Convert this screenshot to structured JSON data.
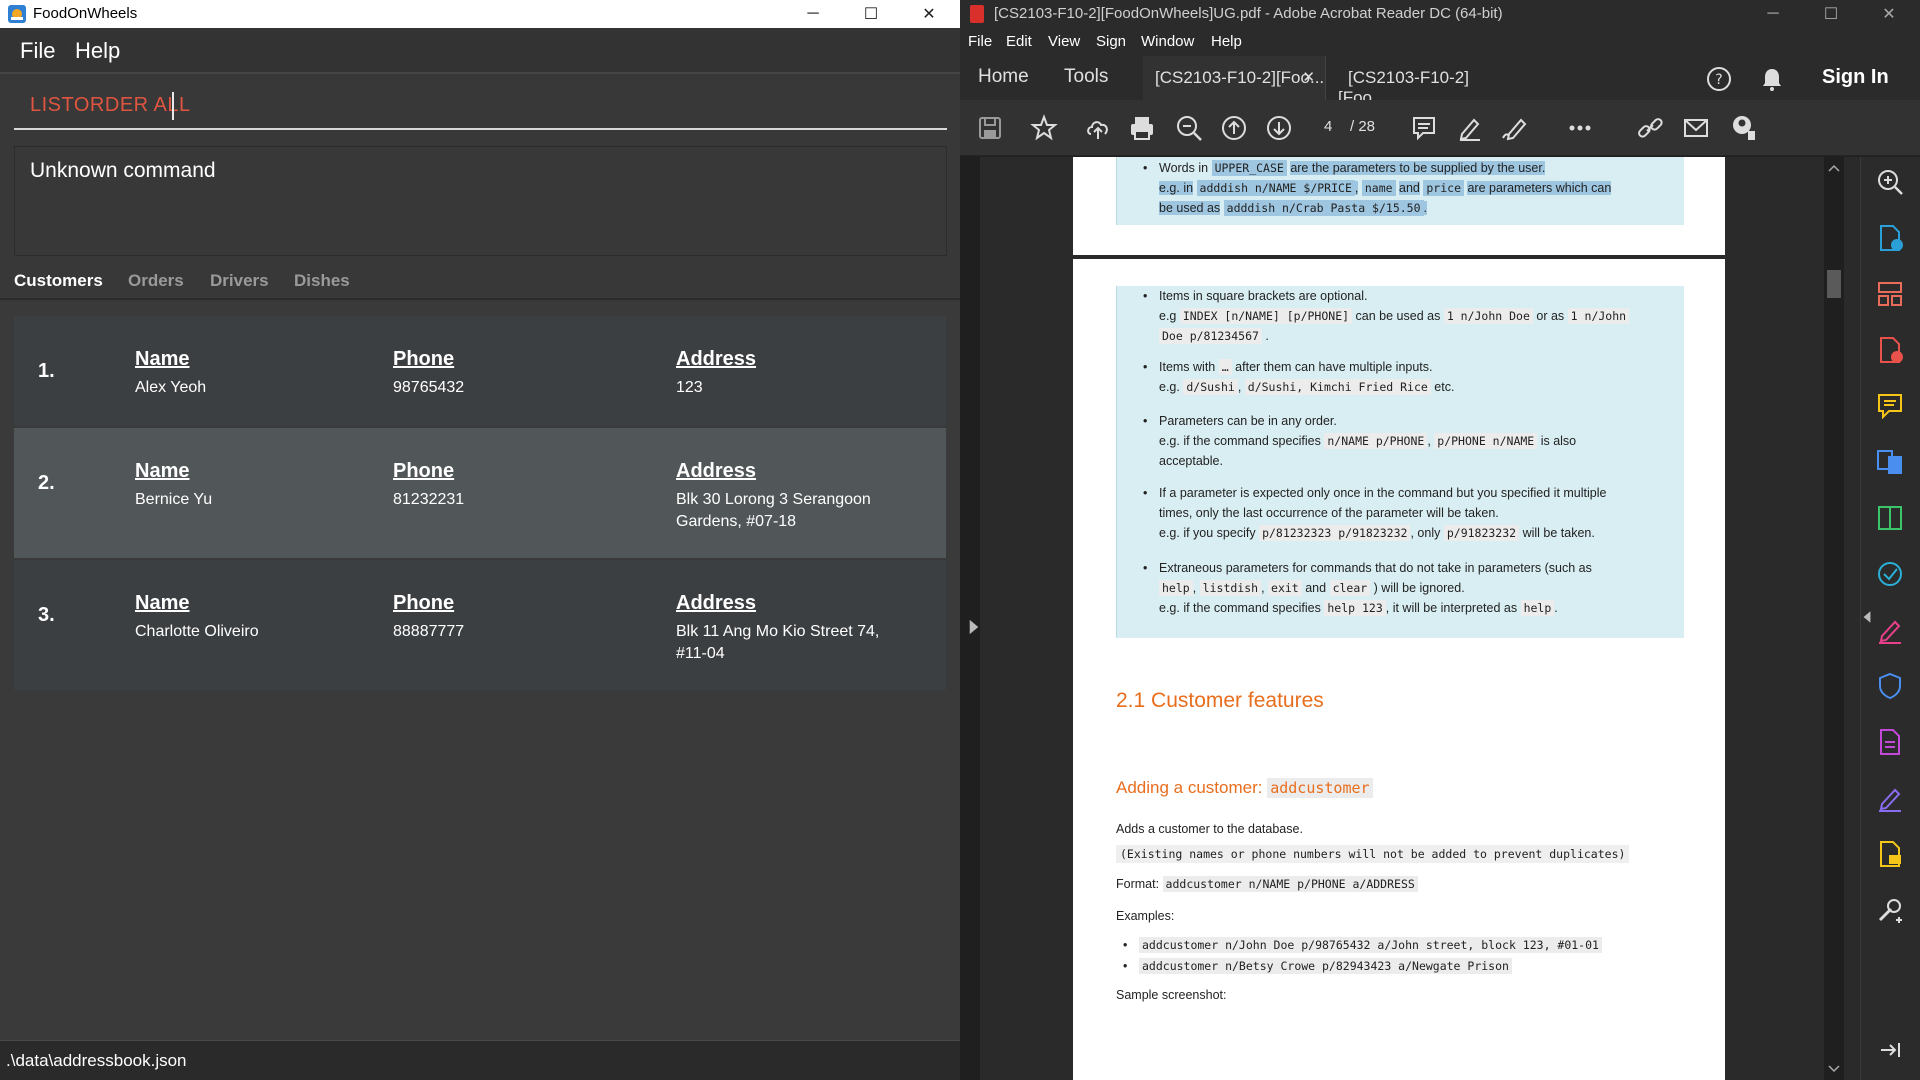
{
  "left_app": {
    "window_title": "FoodOnWheels",
    "menu": [
      "File",
      "Help"
    ],
    "command_input": "LISTORDER ALL",
    "result_text": "Unknown command",
    "tabs": [
      "Customers",
      "Orders",
      "Drivers",
      "Dishes"
    ],
    "active_tab": "Customers",
    "customers": [
      {
        "index": "1.",
        "name_label": "Name",
        "name": "Alex Yeoh",
        "phone_label": "Phone",
        "phone": "98765432",
        "address_label": "Address",
        "address_line1": "123",
        "address_line2": ""
      },
      {
        "index": "2.",
        "name_label": "Name",
        "name": "Bernice Yu",
        "phone_label": "Phone",
        "phone": "81232231",
        "address_label": "Address",
        "address_line1": "Blk 30 Lorong 3 Serangoon",
        "address_line2": "Gardens, #07-18"
      },
      {
        "index": "3.",
        "name_label": "Name",
        "name": "Charlotte Oliveiro",
        "phone_label": "Phone",
        "phone": "88887777",
        "address_label": "Address",
        "address_line1": "Blk 11 Ang Mo Kio Street 74,",
        "address_line2": "#11-04"
      }
    ],
    "status_path": ".\\data\\addressbook.json",
    "colors": {
      "command_text": "#e05540",
      "selected_card": "#515658"
    }
  },
  "right_app": {
    "window_title": "[CS2103-F10-2][FoodOnWheels]UG.pdf - Adobe Acrobat Reader DC (64-bit)",
    "menu": [
      "File",
      "Edit",
      "View",
      "Sign",
      "Window",
      "Help"
    ],
    "nav": [
      "Home",
      "Tools"
    ],
    "doc_tabs": [
      "[CS2103-F10-2][Foo...",
      "[CS2103-F10-2][Foo..."
    ],
    "sign_in": "Sign In",
    "page_current": "4",
    "page_total": "/ 28",
    "doc": {
      "top_note": {
        "b1_a": "Words in",
        "b1_code": "UPPER_CASE",
        "b1_b": "are the parameters to be supplied by the user.",
        "b1_eg": "e.g. in",
        "b1_code2": "adddish n/NAME $/PRICE",
        "b1_comma": ",",
        "b1_code3": "name",
        "b1_and": "and",
        "b1_code4": "price",
        "b1_c": "are parameters which can",
        "b1_d": "be used as",
        "b1_code5": "adddish n/Crab Pasta $/15.50",
        "b1_dot": "."
      },
      "note2": {
        "b1": "Items in square brackets are optional.",
        "b1_eg": "e.g",
        "b1_code1": "INDEX [n/NAME] [p/PHONE]",
        "b1_mid": "can be used as",
        "b1_code2": "1 n/John Doe",
        "b1_or": "or as",
        "b1_code3": "1 n/John",
        "b1_code4": "Doe p/81234567",
        "b1_end": ".",
        "b2_a": "Items with",
        "b2_code": "…",
        "b2_b": "after them can have multiple inputs.",
        "b2_eg": "e.g.",
        "b2_code1": "d/Sushi",
        "b2_comma": ",",
        "b2_code2": "d/Sushi, Kimchi Fried Rice",
        "b2_etc": "etc.",
        "b3": "Parameters can be in any order.",
        "b3_eg": "e.g. if the command specifies",
        "b3_code1": "n/NAME p/PHONE",
        "b3_comma": ",",
        "b3_code2": "p/PHONE n/NAME",
        "b3_end": "is also",
        "b3_end2": "acceptable.",
        "b4_l1": "If a parameter is expected only once in the command but you specified it multiple",
        "b4_l2": "times, only the last occurrence of the parameter will be taken.",
        "b4_eg": "e.g. if you specify",
        "b4_code1": "p/81232323 p/91823232",
        "b4_mid": ", only",
        "b4_code2": "p/91823232",
        "b4_end": "will be taken.",
        "b5_l1": "Extraneous parameters for commands that do not take in parameters (such as",
        "b5_code1": "help",
        "b5_c1": ",",
        "b5_code2": "listdish",
        "b5_c2": ",",
        "b5_code3": "exit",
        "b5_and": "and",
        "b5_code4": "clear",
        "b5_end": ") will be ignored.",
        "b5_eg": "e.g. if the command specifies",
        "b5_code5": "help 123",
        "b5_mid": ", it will be interpreted as",
        "b5_code6": "help",
        "b5_dot": "."
      },
      "section_title": "2.1 Customer features",
      "subsection_prefix": "Adding a customer:",
      "subsection_code": "addcustomer",
      "desc": "Adds a customer to the database.",
      "note_code": "(Existing names or phone numbers will not be added to prevent duplicates)",
      "format_label": "Format:",
      "format_code": "addcustomer n/NAME p/PHONE a/ADDRESS",
      "examples_label": "Examples:",
      "examples": [
        "addcustomer n/John Doe p/98765432 a/John street, block 123, #01-01",
        "addcustomer n/Betsy Crowe p/82943423 a/Newgate Prison"
      ],
      "sample_label": "Sample screenshot:"
    },
    "colors": {
      "heading": "#e86e1e",
      "note_bg": "#d9eef2",
      "highlight": "#9ec6e0"
    }
  }
}
